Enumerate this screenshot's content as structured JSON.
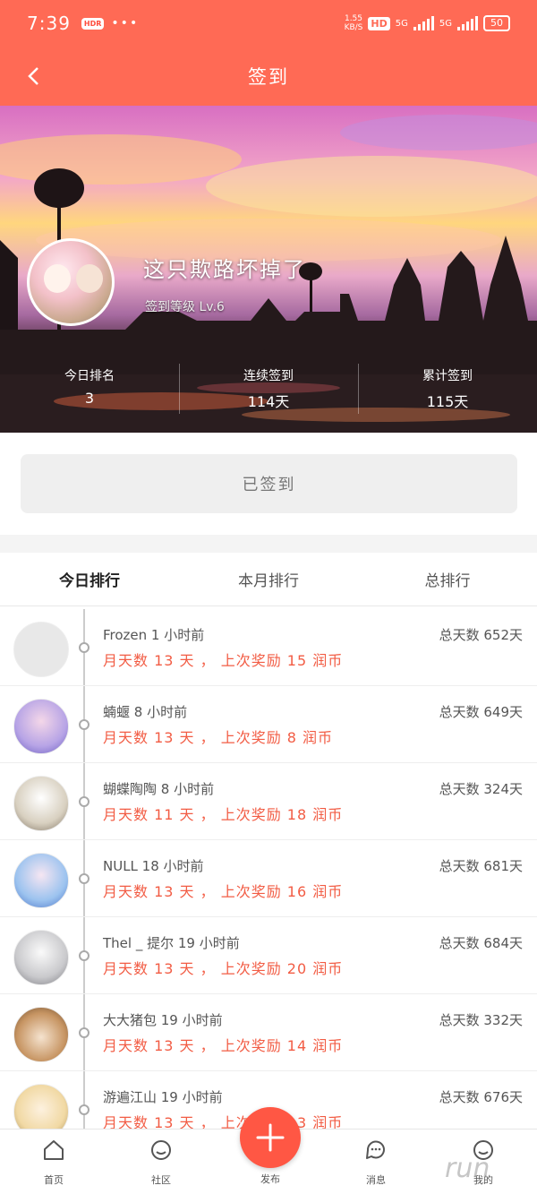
{
  "status": {
    "time": "7:39",
    "badge": "HDR",
    "dots": "•••",
    "speed": "1.55",
    "speed_unit": "KB/S",
    "hd": "HD",
    "net1": "5G",
    "net2": "5G",
    "battery": "50"
  },
  "header": {
    "back_icon": "chevron-left-icon",
    "title": "签到"
  },
  "profile": {
    "name": "这只欺路坏掉了",
    "level": "签到等级 Lv.6"
  },
  "stats": [
    {
      "label": "今日排名",
      "value": "3"
    },
    {
      "label": "连续签到",
      "value": "114天"
    },
    {
      "label": "累计签到",
      "value": "115天"
    }
  ],
  "sign_button": "已签到",
  "tabs": [
    {
      "label": "今日排行",
      "active": true
    },
    {
      "label": "本月排行",
      "active": false
    },
    {
      "label": "总排行",
      "active": false
    }
  ],
  "ranking": [
    {
      "name": "Frozen 1 小时前",
      "total": "总天数 652天",
      "info": "月天数 13 天 ， 上次奖励 15 润币",
      "color": "#e8e8e8"
    },
    {
      "name": "蝻蝘 8 小时前",
      "total": "总天数 649天",
      "info": "月天数 13 天 ， 上次奖励 8 润币",
      "color": "#b7a4e6"
    },
    {
      "name": "蝴蝶陶陶 8 小时前",
      "total": "总天数 324天",
      "info": "月天数 11 天 ， 上次奖励 18 润币",
      "color": "#d8d0c0"
    },
    {
      "name": "NULL 18 小时前",
      "total": "总天数 681天",
      "info": "月天数 13 天 ， 上次奖励 16 润币",
      "color": "#9cc3ef"
    },
    {
      "name": "Thel _ 提尔 19 小时前",
      "total": "总天数 684天",
      "info": "月天数 13 天 ， 上次奖励 20 润币",
      "color": "#c9c9cc"
    },
    {
      "name": "大大猪包 19 小时前",
      "total": "总天数 332天",
      "info": "月天数 13 天 ， 上次奖励 14 润币",
      "color": "#a77a52"
    },
    {
      "name": "游遍江山 19 小时前",
      "total": "总天数 676天",
      "info": "月天数 13 天 ， 上次奖励 13 润币",
      "color": "#f1d9a4"
    }
  ],
  "nav": [
    {
      "label": "首页",
      "icon": "home-icon"
    },
    {
      "label": "社区",
      "icon": "community-icon"
    },
    {
      "label": "发布",
      "icon": "plus-icon"
    },
    {
      "label": "消息",
      "icon": "message-icon"
    },
    {
      "label": "我的",
      "icon": "user-icon"
    }
  ],
  "watermark": "run"
}
